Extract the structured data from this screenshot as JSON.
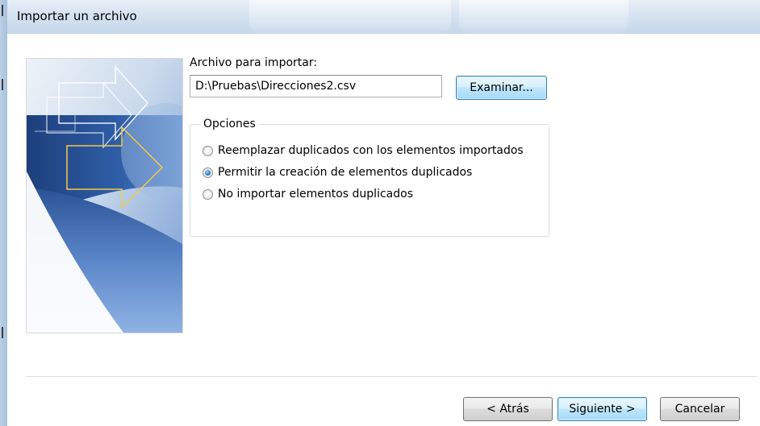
{
  "window": {
    "title": "Importar un archivo"
  },
  "file": {
    "label": "Archivo para importar:",
    "value": "D:\\Pruebas\\Direcciones2.csv",
    "browse_label": "Examinar..."
  },
  "options": {
    "legend": "Opciones",
    "items": [
      {
        "label": "Reemplazar duplicados con los elementos importados",
        "checked": false
      },
      {
        "label": "Permitir la creación de elementos duplicados",
        "checked": true
      },
      {
        "label": "No importar elementos duplicados",
        "checked": false
      }
    ]
  },
  "footer": {
    "back_label": "< Atrás",
    "next_label": "Siguiente >",
    "cancel_label": "Cancelar"
  },
  "colors": {
    "titlebar": "#d6e3f1",
    "image_blue": "#2c4f8e",
    "arrow_yellow": "#f2c94c",
    "focus_border": "#3c7fb1"
  },
  "icons": {
    "side_image": "import-export-arrows-icon"
  }
}
